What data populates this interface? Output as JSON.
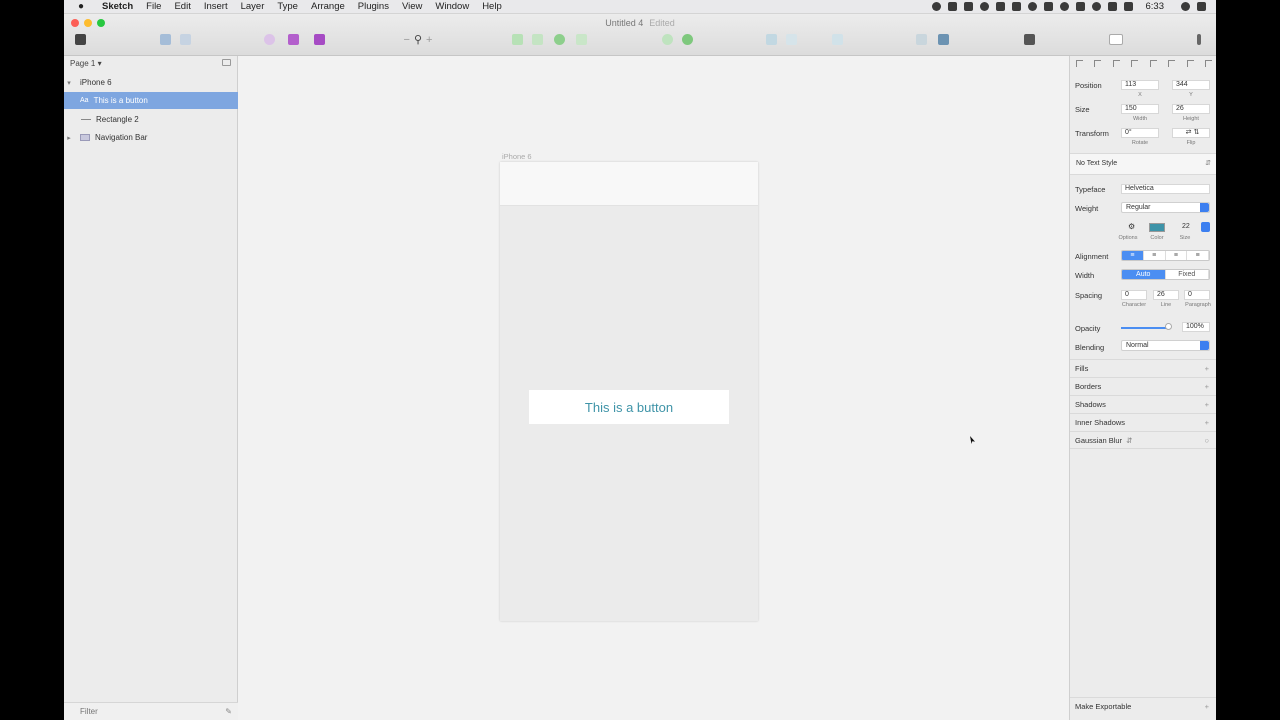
{
  "menubar": {
    "app_name": "Sketch",
    "items": [
      "File",
      "Edit",
      "Insert",
      "Layer",
      "Type",
      "Arrange",
      "Plugins",
      "View",
      "Window",
      "Help"
    ],
    "clock": "6:33"
  },
  "window": {
    "title": "Untitled 4",
    "edited": "Edited"
  },
  "layers": {
    "page_selector": "Page 1",
    "rows": [
      {
        "label": "iPhone 6",
        "prefix": ""
      },
      {
        "label": "This is a button",
        "prefix": "Aa"
      },
      {
        "label": "Rectangle 2",
        "prefix": ""
      },
      {
        "label": "Navigation Bar",
        "prefix": ""
      }
    ],
    "search_placeholder": "Filter"
  },
  "canvas": {
    "artboard_label": "iPhone 6",
    "button_text": "This is a button"
  },
  "inspector": {
    "position_label": "Position",
    "x_value": "113",
    "y_value": "344",
    "x_sub": "X",
    "y_sub": "Y",
    "size_label": "Size",
    "width_value": "150",
    "height_value": "26",
    "width_sub": "Width",
    "height_sub": "Height",
    "transform_label": "Transform",
    "rotate_value": "0°",
    "rotate_sub": "Rotate",
    "flip_sub": "Flip",
    "text_style": "No Text Style",
    "typeface_label": "Typeface",
    "typeface_value": "Helvetica",
    "weight_label": "Weight",
    "weight_value": "Regular",
    "options_sub": "Options",
    "color_sub": "Color",
    "size_sub": "Size",
    "font_size_value": "22",
    "alignment_label": "Alignment",
    "width_label": "Width",
    "width_auto": "Auto",
    "width_fixed": "Fixed",
    "spacing_label": "Spacing",
    "character_value": "0",
    "line_value": "26",
    "paragraph_value": "0",
    "character_sub": "Character",
    "line_sub": "Line",
    "paragraph_sub": "Paragraph",
    "opacity_label": "Opacity",
    "opacity_value": "100%",
    "blending_label": "Blending",
    "blending_value": "Normal",
    "sections": [
      "Fills",
      "Borders",
      "Shadows",
      "Inner Shadows",
      "Gaussian Blur"
    ],
    "make_exportable": "Make Exportable"
  },
  "colors": {
    "button_text": "#3f94a8",
    "selection": "#7ea6e0",
    "accent": "#4b8ef2"
  }
}
